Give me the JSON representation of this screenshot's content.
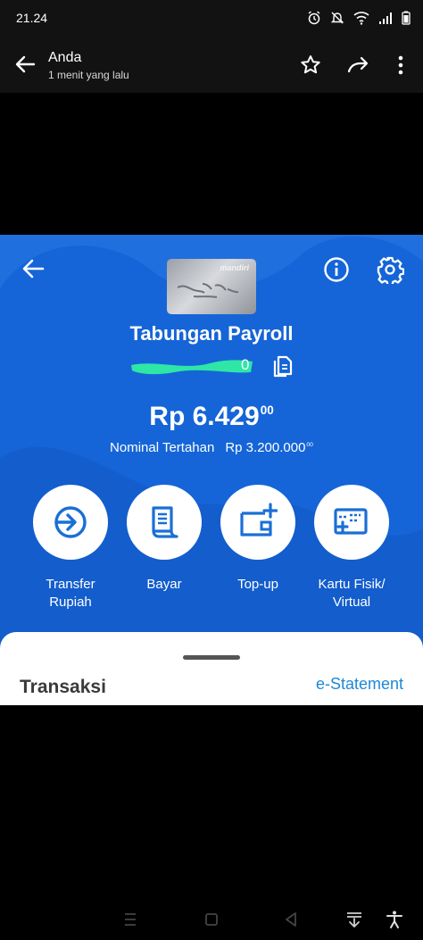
{
  "status_bar": {
    "time": "21.24",
    "icons": [
      "alarm-icon",
      "mute-icon",
      "wifi-icon",
      "signal-icon",
      "battery-icon"
    ]
  },
  "app_bar": {
    "title": "Anda",
    "subtitle": "1 menit yang lalu",
    "icons": [
      "back-arrow-icon",
      "star-icon",
      "forward-icon",
      "more-vert-icon"
    ]
  },
  "banking_screen": {
    "card_brand": "mandiri",
    "account_name": "Tabungan Payroll",
    "account_number_tail": "0",
    "balance_main": "Rp 6.429",
    "balance_decimals": "00",
    "held_label": "Nominal Tertahan",
    "held_amount_main": "Rp 3.200.000",
    "held_amount_decimals": "00",
    "actions": [
      {
        "label": "Transfer\nRupiah",
        "icon": "transfer-icon"
      },
      {
        "label": "Bayar",
        "icon": "bill-icon"
      },
      {
        "label": "Top-up",
        "icon": "wallet-add-icon"
      },
      {
        "label": "Kartu Fisik/\nVirtual",
        "icon": "card-add-icon"
      }
    ],
    "sheet": {
      "title": "Transaksi",
      "link": "e-Statement"
    },
    "colors": {
      "primary_blue": "#1565d8",
      "icon_blue": "#1a6fd6",
      "link_blue": "#1e88d6",
      "redaction_green": "#2ee6a6"
    }
  },
  "nav_bar": {
    "icons": [
      "recents-icon",
      "home-icon",
      "back-triangle-icon",
      "screenshot-icon",
      "accessibility-icon"
    ]
  }
}
